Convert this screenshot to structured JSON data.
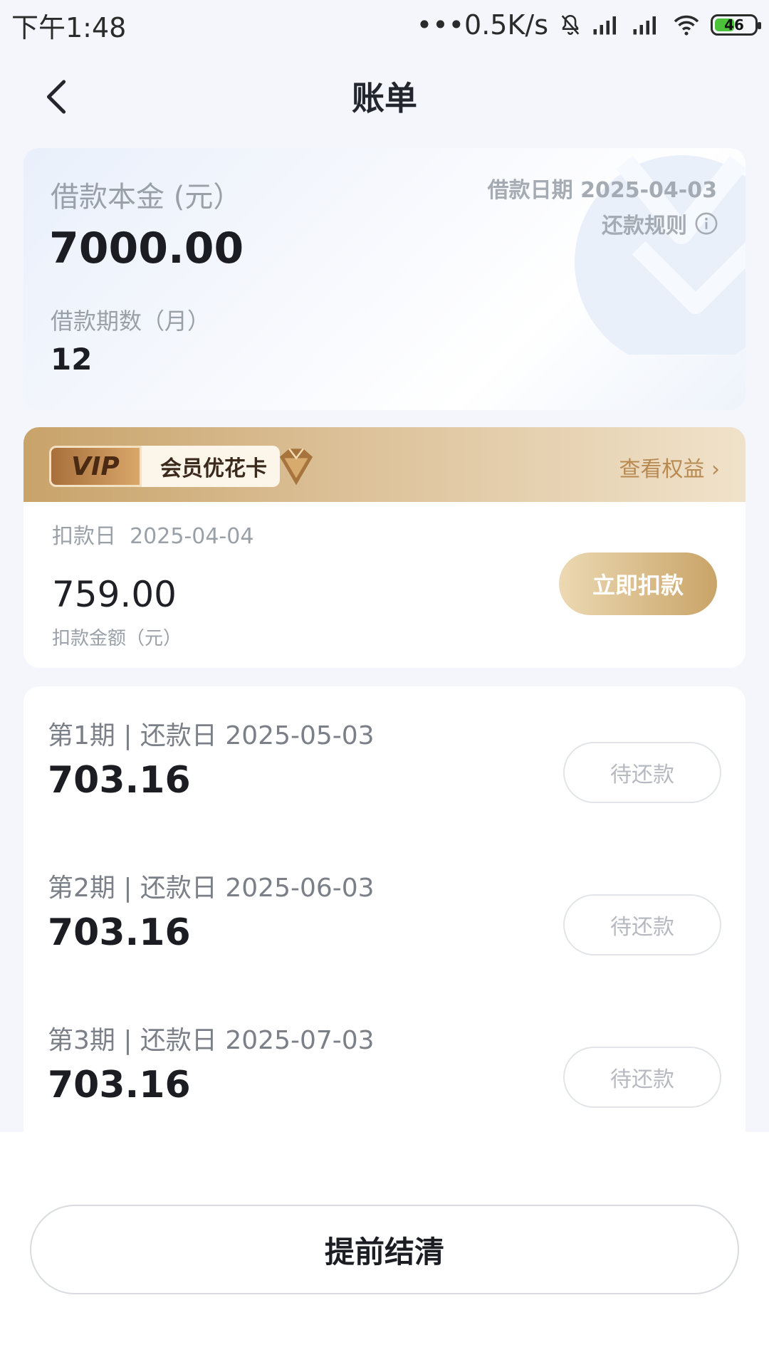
{
  "status_bar": {
    "time": "下午1:48",
    "network_speed": "•••0.5K/s",
    "battery": "46"
  },
  "header": {
    "title": "账单",
    "back_icon": "chevron-left-icon"
  },
  "loan": {
    "principal_label": "借款本金 (元）",
    "principal_value": "7000.00",
    "periods_label": "借款期数（月）",
    "periods_value": "12",
    "date_text": "借款日期 2025-04-03",
    "rules_label": "还款规则"
  },
  "vip": {
    "tag": "VIP",
    "name": "会员优花卡",
    "link_label": "查看权益",
    "deduct_date_label": "扣款日",
    "deduct_date_value": "2025-04-04",
    "deduct_amount": "759.00",
    "deduct_unit_label": "扣款金额（元）",
    "deduct_button": "立即扣款"
  },
  "installments": [
    {
      "info": "第1期 | 还款日 2025-05-03",
      "amount": "703.16",
      "status": "待还款"
    },
    {
      "info": "第2期 | 还款日 2025-06-03",
      "amount": "703.16",
      "status": "待还款"
    },
    {
      "info": "第3期 | 还款日 2025-07-03",
      "amount": "703.16",
      "status": "待还款"
    }
  ],
  "footer": {
    "payoff_button": "提前结清"
  },
  "colors": {
    "accent_gold": "#c9a468",
    "text_dark": "#1c1d22",
    "text_muted": "#9aa0a8"
  }
}
